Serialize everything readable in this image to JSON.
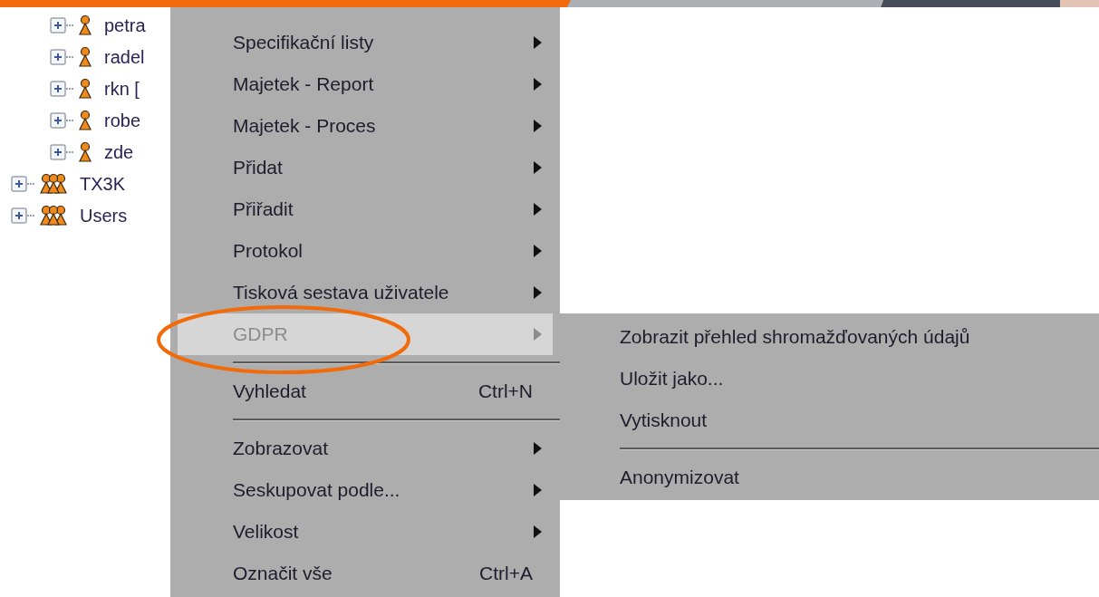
{
  "tree": [
    {
      "children": [
        {
          "label": "petra",
          "kind": "user",
          "expanded": false
        },
        {
          "label": "radel",
          "kind": "user",
          "expanded": false
        },
        {
          "label": "rkn [",
          "kind": "user",
          "expanded": false
        },
        {
          "label": "robe",
          "kind": "user",
          "expanded": false
        },
        {
          "label": "zde",
          "kind": "user",
          "expanded": false
        }
      ]
    },
    {
      "label": "TX3K",
      "kind": "group",
      "expanded": false
    },
    {
      "label": "Users",
      "kind": "group",
      "expanded": false
    }
  ],
  "context_menu": {
    "items": [
      {
        "kind": "item",
        "label": "Specifikační listy",
        "submenu": true,
        "selected": false,
        "disabled": false
      },
      {
        "kind": "item",
        "label": "Majetek - Report",
        "submenu": true,
        "selected": false,
        "disabled": false
      },
      {
        "kind": "item",
        "label": "Majetek - Proces",
        "submenu": true,
        "selected": false,
        "disabled": false
      },
      {
        "kind": "item",
        "label": "Přidat",
        "submenu": true,
        "selected": false,
        "disabled": false
      },
      {
        "kind": "item",
        "label": "Přiřadit",
        "submenu": true,
        "selected": false,
        "disabled": false
      },
      {
        "kind": "item",
        "label": "Protokol",
        "submenu": true,
        "selected": false,
        "disabled": false
      },
      {
        "kind": "item",
        "label": "Tisková sestava uživatele",
        "submenu": true,
        "selected": false,
        "disabled": false
      },
      {
        "kind": "item",
        "label": "GDPR",
        "submenu": true,
        "selected": true,
        "disabled": true
      },
      {
        "kind": "separator"
      },
      {
        "kind": "item",
        "label": "Vyhledat",
        "shortcut": "Ctrl+N",
        "submenu": false,
        "selected": false,
        "disabled": false
      },
      {
        "kind": "separator"
      },
      {
        "kind": "item",
        "label": "Zobrazovat",
        "submenu": true,
        "selected": false,
        "disabled": false
      },
      {
        "kind": "item",
        "label": "Seskupovat podle...",
        "submenu": true,
        "selected": false,
        "disabled": false
      },
      {
        "kind": "item",
        "label": "Velikost",
        "submenu": true,
        "selected": false,
        "disabled": false
      },
      {
        "kind": "item",
        "label": "Označit vše",
        "shortcut": "Ctrl+A",
        "submenu": false,
        "selected": false,
        "disabled": false
      }
    ]
  },
  "submenu": {
    "items": [
      {
        "kind": "item",
        "label": "Zobrazit přehled shromažďovaných údajů",
        "selected": false,
        "disabled": false
      },
      {
        "kind": "item",
        "label": "Uložit jako...",
        "selected": false,
        "disabled": false
      },
      {
        "kind": "item",
        "label": "Vytisknout",
        "selected": false,
        "disabled": false
      },
      {
        "kind": "separator"
      },
      {
        "kind": "item",
        "label": "Anonymizovat",
        "selected": false,
        "disabled": false
      }
    ]
  }
}
